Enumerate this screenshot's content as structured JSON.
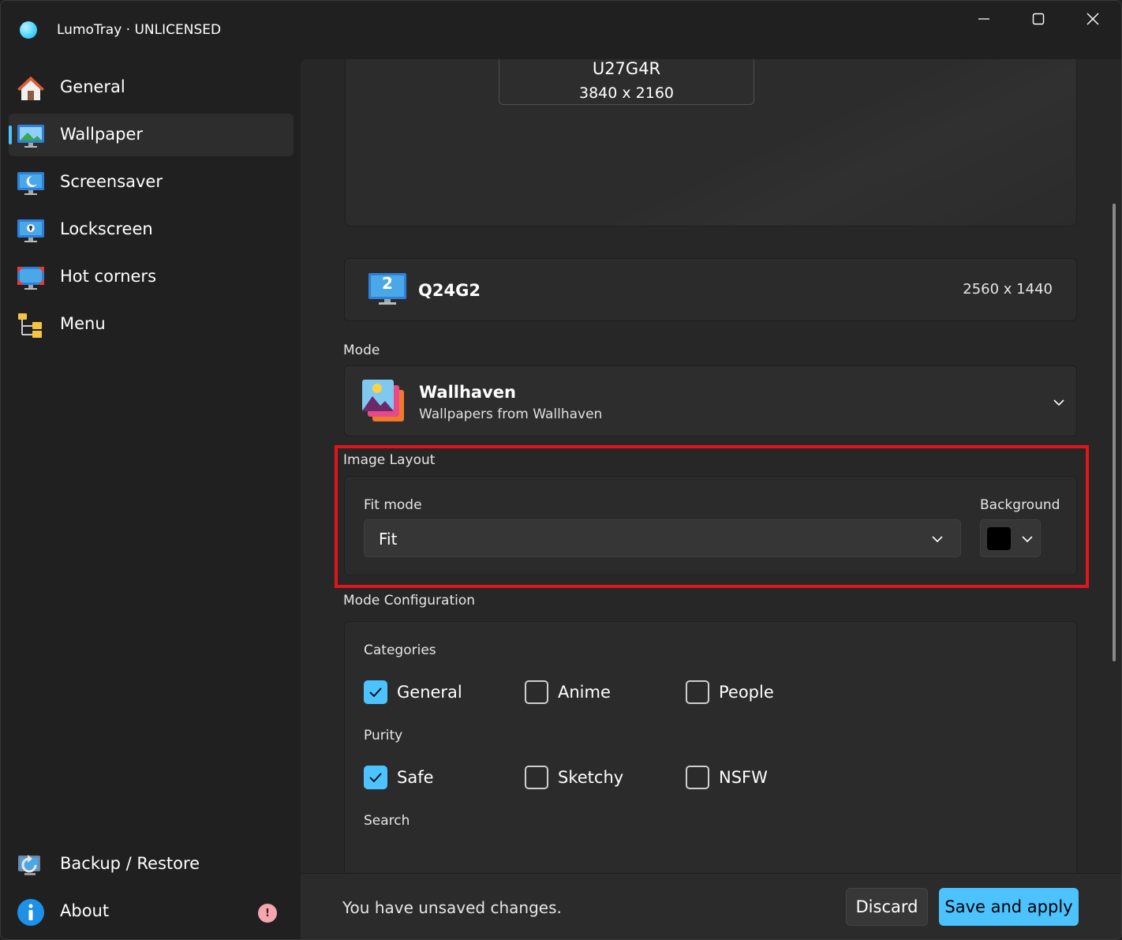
{
  "window": {
    "title": "LumoTray · UNLICENSED"
  },
  "sidebar": {
    "items": [
      {
        "label": "General",
        "icon": "home-icon"
      },
      {
        "label": "Wallpaper",
        "icon": "wallpaper-icon",
        "active": true
      },
      {
        "label": "Screensaver",
        "icon": "screensaver-icon"
      },
      {
        "label": "Lockscreen",
        "icon": "lockscreen-icon"
      },
      {
        "label": "Hot corners",
        "icon": "hot-corners-icon"
      },
      {
        "label": "Menu",
        "icon": "menu-tree-icon"
      }
    ],
    "footer": [
      {
        "label": "Backup / Restore",
        "icon": "backup-icon"
      },
      {
        "label": "About",
        "icon": "info-icon",
        "badge": "!"
      }
    ]
  },
  "monitors": {
    "preview": {
      "name": "U27G4R",
      "resolution": "3840 x 2160"
    },
    "selected": {
      "number": "2",
      "name": "Q24G2",
      "resolution": "2560 x 1440"
    }
  },
  "mode": {
    "label": "Mode",
    "name": "Wallhaven",
    "description": "Wallpapers from Wallhaven"
  },
  "image_layout": {
    "label": "Image Layout",
    "fit_mode_label": "Fit mode",
    "fit_mode_value": "Fit",
    "background_label": "Background",
    "background_color": "#000000"
  },
  "mode_config": {
    "label": "Mode Configuration",
    "categories_label": "Categories",
    "categories": [
      {
        "label": "General",
        "checked": true
      },
      {
        "label": "Anime",
        "checked": false
      },
      {
        "label": "People",
        "checked": false
      }
    ],
    "purity_label": "Purity",
    "purity": [
      {
        "label": "Safe",
        "checked": true
      },
      {
        "label": "Sketchy",
        "checked": false
      },
      {
        "label": "NSFW",
        "checked": false
      }
    ],
    "search_label": "Search"
  },
  "footer_bar": {
    "status": "You have unsaved changes.",
    "discard": "Discard",
    "save": "Save and apply"
  },
  "colors": {
    "accent": "#4cc2ff",
    "highlight": "#e3141c"
  }
}
